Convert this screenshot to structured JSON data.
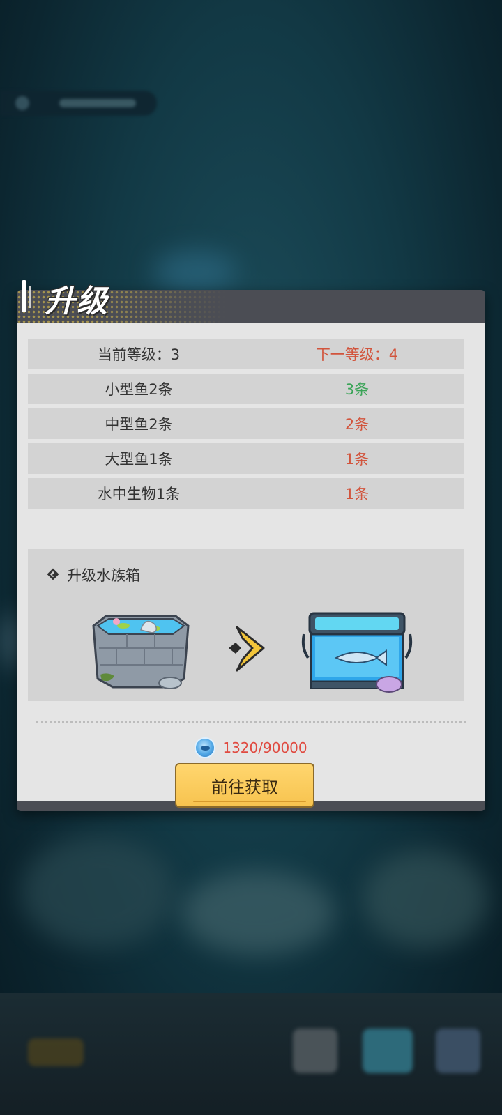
{
  "dialog": {
    "title": "升级",
    "current_level_label": "当前等级：3",
    "next_level_label": "下一等级：4",
    "rows": [
      {
        "current": "小型鱼2条",
        "next": "3条",
        "next_color": "#3aa457"
      },
      {
        "current": "中型鱼2条",
        "next": "2条",
        "next_color": "#d2543c"
      },
      {
        "current": "大型鱼1条",
        "next": "1条",
        "next_color": "#d2543c"
      },
      {
        "current": "水中生物1条",
        "next": "1条",
        "next_color": "#d2543c"
      }
    ],
    "upgrade_heading": "升级水族箱",
    "current_tank_icon": "stone-pond-tank-icon",
    "next_tank_icon": "glass-aquarium-tank-icon",
    "cost_icon": "fish-coin-icon",
    "cost_text": "1320/90000",
    "go_button_label": "前往获取"
  },
  "colors": {
    "accent_red": "#d2543c",
    "accent_green": "#3aa457",
    "button_yellow": "#f7c34f",
    "dialog_header": "#4b4d54"
  }
}
